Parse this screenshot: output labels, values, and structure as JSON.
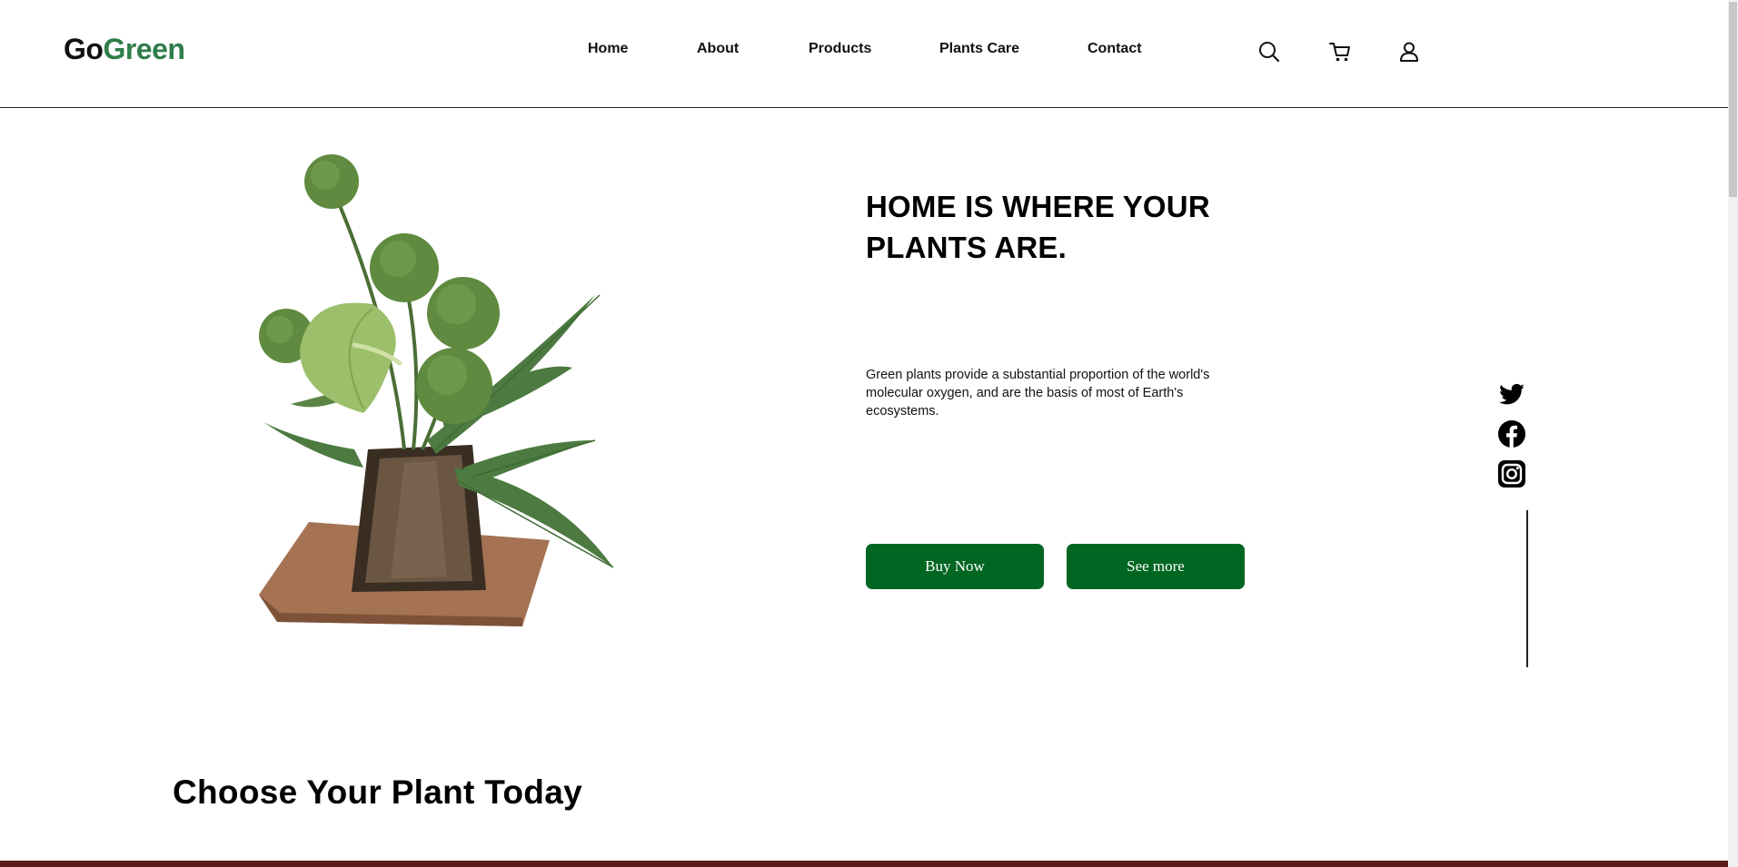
{
  "brand": {
    "part1": "Go",
    "part2": "Green"
  },
  "nav": {
    "items": [
      "Home",
      "About",
      "Products",
      "Plants Care",
      "Contact"
    ]
  },
  "header_icons": [
    "search-icon",
    "cart-icon",
    "user-icon"
  ],
  "hero": {
    "headline_line1": "HOME IS WHERE YOUR",
    "headline_line2": "PLANTS ARE.",
    "description": "Green plants provide a substantial proportion of the world's molecular oxygen, and are the basis of most of Earth's ecosystems.",
    "buttons": {
      "buy": "Buy Now",
      "more": "See more"
    },
    "image": "potted-plant-arrangement"
  },
  "social": [
    "twitter-icon",
    "facebook-icon",
    "instagram-icon"
  ],
  "section": {
    "title": "Choose Your Plant Today"
  },
  "colors": {
    "brand_green": "#2e7d4a",
    "button_green": "#006622"
  }
}
